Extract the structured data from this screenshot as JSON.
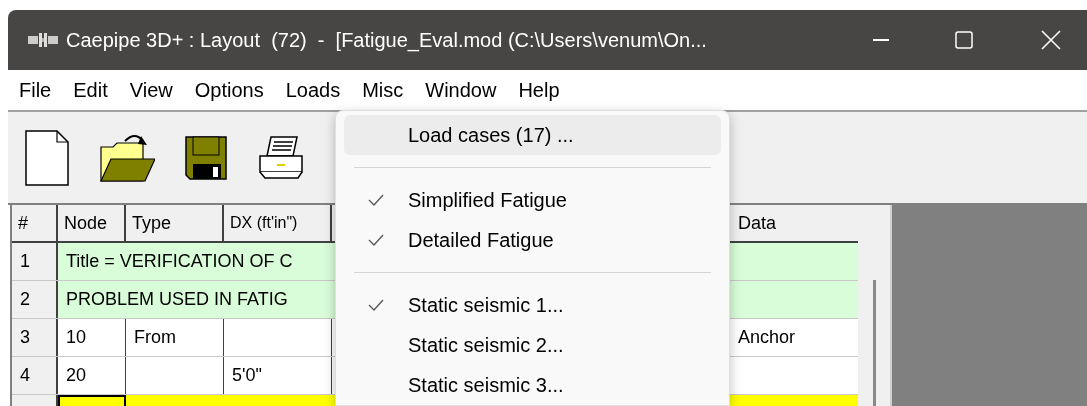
{
  "window": {
    "title": "Caepipe 3D+ : Layout  (72)  -  [Fatigue_Eval.mod (C:\\Users\\venum\\On..."
  },
  "menu_bar": [
    {
      "label": "File"
    },
    {
      "label": "Edit"
    },
    {
      "label": "View"
    },
    {
      "label": "Options"
    },
    {
      "label": "Loads"
    },
    {
      "label": "Misc"
    },
    {
      "label": "Window"
    },
    {
      "label": "Help"
    }
  ],
  "loads_menu": [
    {
      "kind": "item",
      "label": "Load cases (17) ...",
      "checked": false,
      "selected": true
    },
    {
      "kind": "separator"
    },
    {
      "kind": "item",
      "label": "Simplified Fatigue",
      "checked": true,
      "selected": false
    },
    {
      "kind": "item",
      "label": "Detailed Fatigue",
      "checked": true,
      "selected": false
    },
    {
      "kind": "separator"
    },
    {
      "kind": "item",
      "label": "Static seismic 1...",
      "checked": true,
      "selected": false
    },
    {
      "kind": "item",
      "label": "Static seismic 2...",
      "checked": false,
      "selected": false
    },
    {
      "kind": "item",
      "label": "Static seismic 3...",
      "checked": false,
      "selected": false
    }
  ],
  "table": {
    "columns": [
      "#",
      "Node",
      "Type",
      "DX (ft'in\")"
    ],
    "last_column": "Data",
    "rows": [
      {
        "kind": "title",
        "number": "1",
        "text": "Title = VERIFICATION OF C"
      },
      {
        "kind": "title",
        "number": "2",
        "text": "PROBLEM USED IN FATIG"
      },
      {
        "kind": "data",
        "number": "3",
        "cells": [
          "10",
          "From",
          ""
        ],
        "data": "Anchor"
      },
      {
        "kind": "data",
        "number": "4",
        "cells": [
          "20",
          "",
          "5'0\""
        ]
      },
      {
        "kind": "current"
      }
    ]
  }
}
